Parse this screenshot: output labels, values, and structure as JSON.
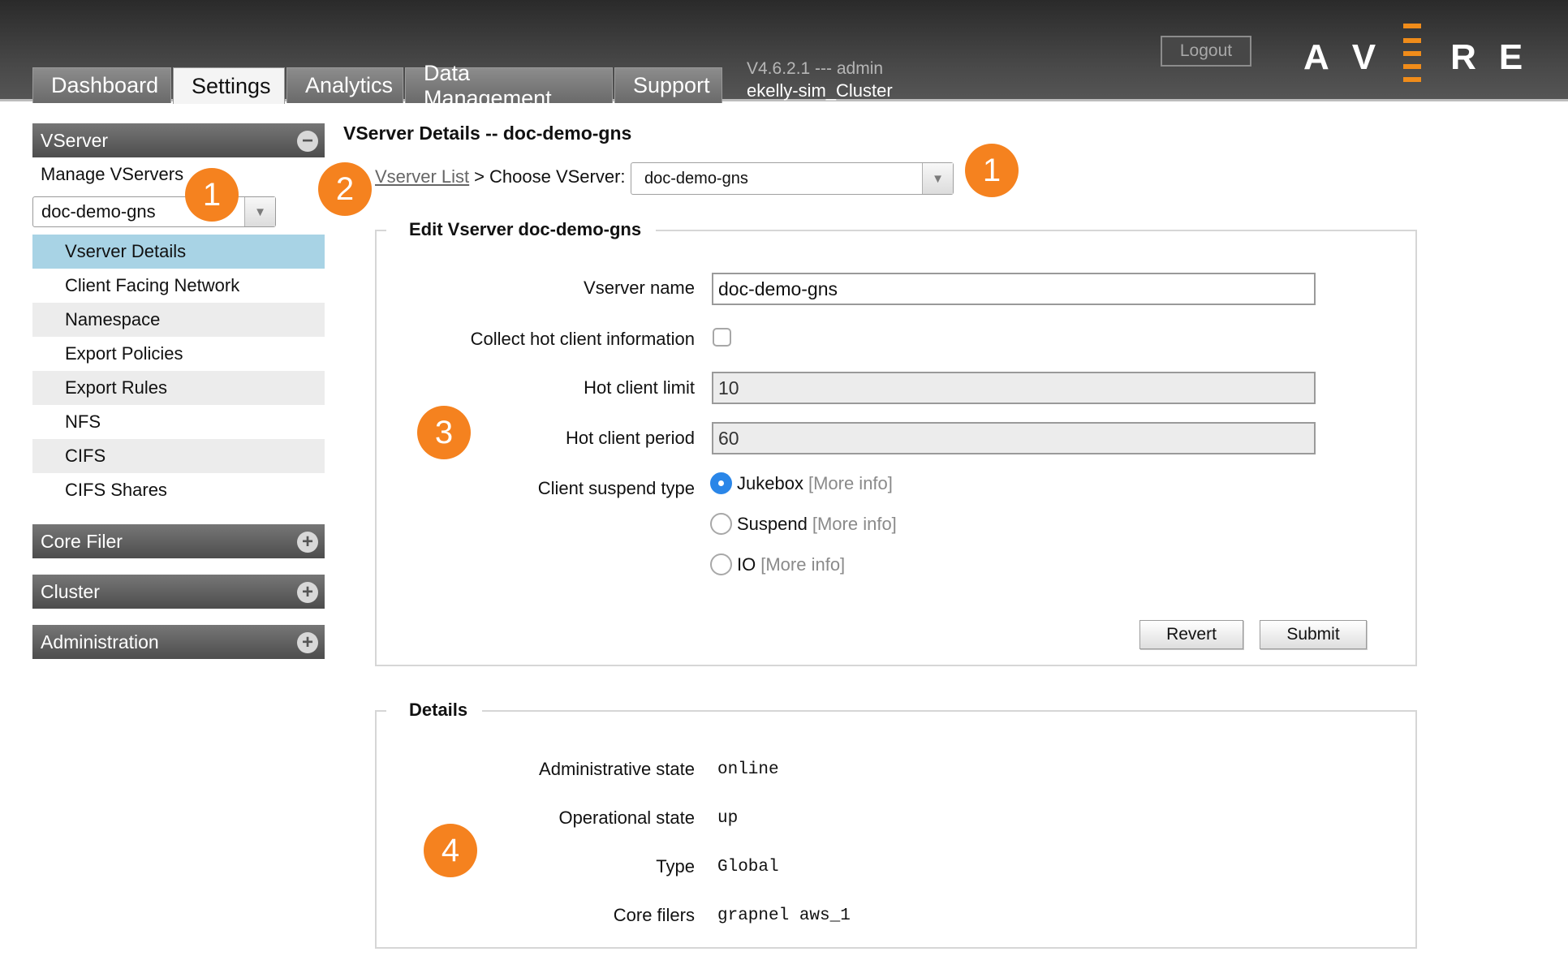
{
  "header": {
    "tabs": [
      {
        "label": "Dashboard"
      },
      {
        "label": "Settings"
      },
      {
        "label": "Analytics"
      },
      {
        "label": "Data Management"
      },
      {
        "label": "Support"
      }
    ],
    "active_tab": "Settings",
    "version": "V4.6.2.1 --- admin",
    "cluster": "ekelly-sim_Cluster",
    "logout_label": "Logout",
    "logo_letters": [
      "A",
      "V",
      "R",
      "E"
    ],
    "logo_alt": "AVERE",
    "accent_color": "#f5821f"
  },
  "sidebar": {
    "vserver_header": "VServer",
    "manage_label": "Manage VServers",
    "selected_vserver": "doc-demo-gns",
    "items": [
      {
        "label": "Vserver Details",
        "selected": true
      },
      {
        "label": "Client Facing Network"
      },
      {
        "label": "Namespace"
      },
      {
        "label": "Export Policies"
      },
      {
        "label": "Export Rules"
      },
      {
        "label": "NFS"
      },
      {
        "label": "CIFS"
      },
      {
        "label": "CIFS Shares"
      }
    ],
    "sections": [
      {
        "label": "Core Filer"
      },
      {
        "label": "Cluster"
      },
      {
        "label": "Administration"
      }
    ]
  },
  "main": {
    "title": "VServer Details -- doc-demo-gns",
    "breadcrumb_link": "Vserver List",
    "breadcrumb_sep": ">",
    "choose_label": "Choose VServer:",
    "choose_value": "doc-demo-gns",
    "edit": {
      "legend": "Edit Vserver doc-demo-gns",
      "name_label": "Vserver name",
      "name_value": "doc-demo-gns",
      "collect_label": "Collect hot client information",
      "limit_label": "Hot client limit",
      "limit_value": "10",
      "period_label": "Hot client period",
      "period_value": "60",
      "suspend_label": "Client suspend type",
      "options": [
        {
          "label": "Jukebox",
          "more": "[More info]",
          "selected": true
        },
        {
          "label": "Suspend",
          "more": "[More info]"
        },
        {
          "label": "IO",
          "more": "[More info]"
        }
      ],
      "revert_label": "Revert",
      "submit_label": "Submit"
    },
    "details": {
      "legend": "Details",
      "rows": [
        {
          "label": "Administrative state",
          "value": "online"
        },
        {
          "label": "Operational state",
          "value": "up"
        },
        {
          "label": "Type",
          "value": "Global"
        },
        {
          "label": "Core filers",
          "value": "grapnel aws_1"
        }
      ]
    }
  },
  "callouts": [
    "1",
    "2",
    "1",
    "3",
    "4"
  ]
}
